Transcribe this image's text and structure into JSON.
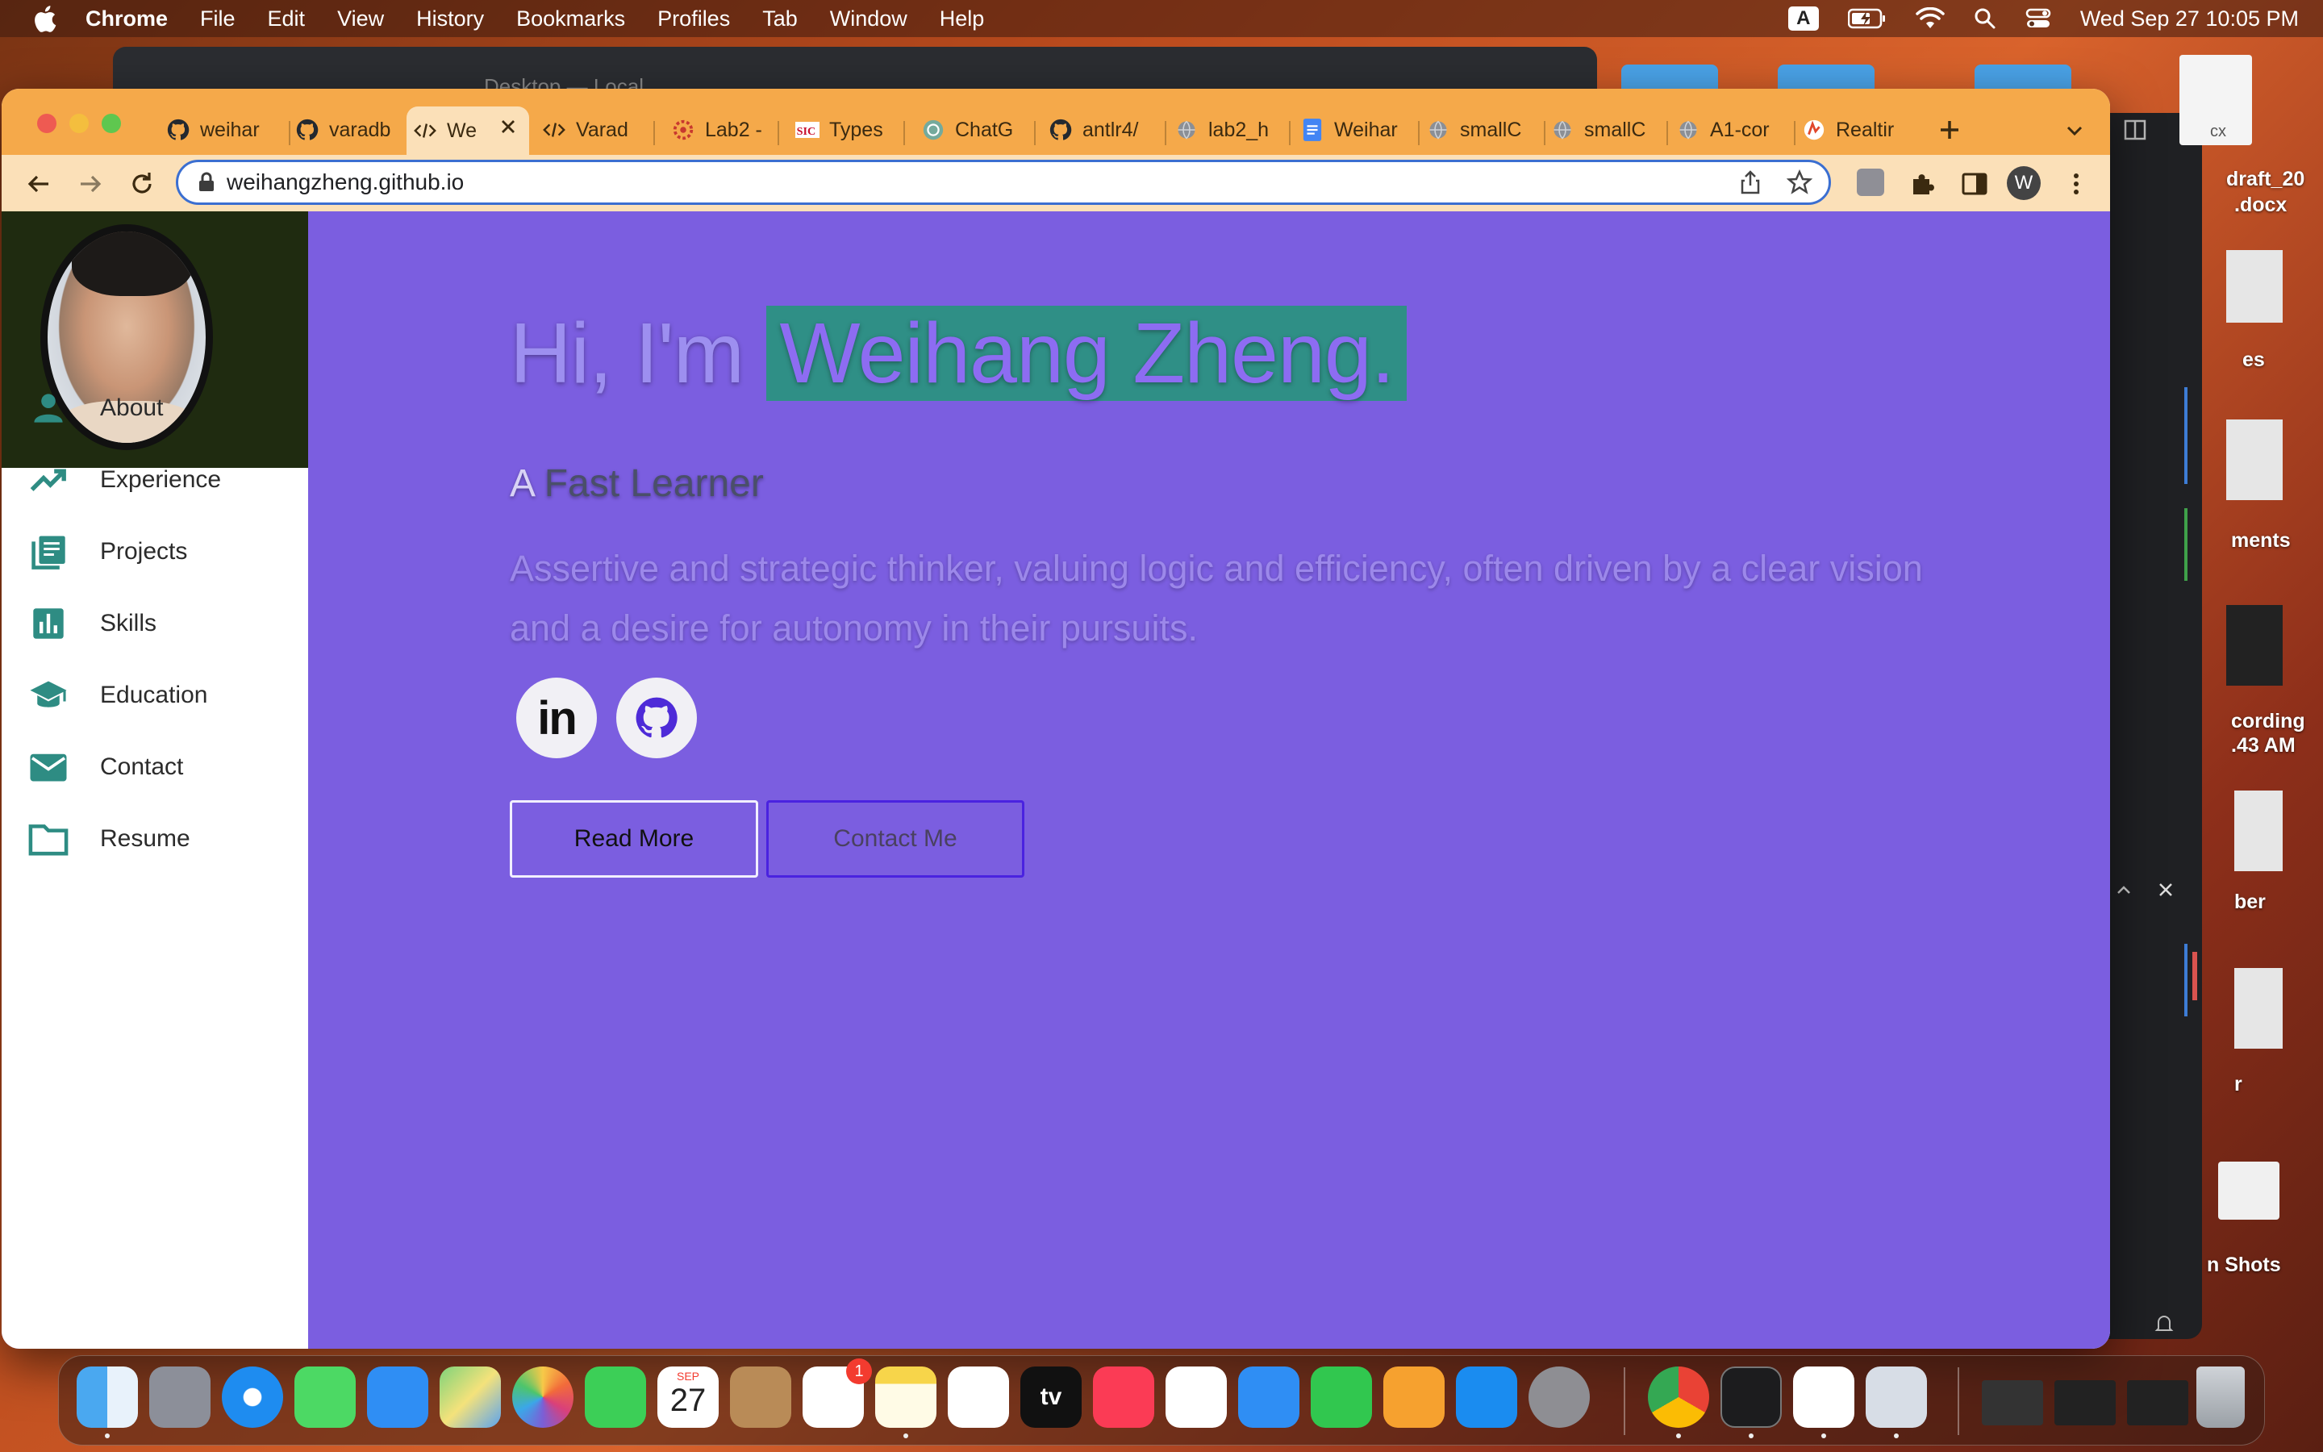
{
  "menubar": {
    "items": [
      "Chrome",
      "File",
      "Edit",
      "View",
      "History",
      "Bookmarks",
      "Profiles",
      "Tab",
      "Window",
      "Help"
    ],
    "input_badge": "A",
    "clock": "Wed Sep 27  10:05 PM"
  },
  "desktop": {
    "labels": [
      "draft_20",
      ".docx",
      "es",
      "ments",
      "cording",
      ".43 AM",
      "ber",
      "r",
      "n Shots",
      "cx"
    ]
  },
  "background_window": {
    "title": "Desktop — Local"
  },
  "tabs": [
    {
      "label": "weihar",
      "icon": "github-icon"
    },
    {
      "label": "varadb",
      "icon": "github-icon"
    },
    {
      "label": "We",
      "icon": "code-icon",
      "active": true
    },
    {
      "label": "Varad",
      "icon": "code-icon"
    },
    {
      "label": "Lab2 -",
      "icon": "gear-red-icon"
    },
    {
      "label": "Types",
      "icon": "sic-icon"
    },
    {
      "label": "ChatG",
      "icon": "openai-icon"
    },
    {
      "label": "antlr4/",
      "icon": "github-icon"
    },
    {
      "label": "lab2_h",
      "icon": "globe-icon"
    },
    {
      "label": "Weihar",
      "icon": "docs-icon"
    },
    {
      "label": "smallC",
      "icon": "globe-icon"
    },
    {
      "label": "smallC",
      "icon": "globe-icon"
    },
    {
      "label": "A1-cor",
      "icon": "globe-icon"
    },
    {
      "label": "Realtir",
      "icon": "realtime-icon"
    }
  ],
  "toolbar": {
    "url": "weihangzheng.github.io",
    "profile_initial": "W"
  },
  "sidebar": {
    "items": [
      {
        "label": "About",
        "icon": "person-icon"
      },
      {
        "label": "Experience",
        "icon": "trending-up-icon"
      },
      {
        "label": "Projects",
        "icon": "articles-icon"
      },
      {
        "label": "Skills",
        "icon": "bar-chart-icon"
      },
      {
        "label": "Education",
        "icon": "school-icon"
      },
      {
        "label": "Contact",
        "icon": "mail-icon"
      },
      {
        "label": "Resume",
        "icon": "folder-icon"
      }
    ]
  },
  "hero": {
    "greeting": "Hi, I'm ",
    "name": "Weihang Zheng.",
    "subtitle_first": "A",
    "subtitle_rest": " Fast Learner",
    "description": "Assertive and strategic thinker, valuing logic and efficiency, often driven by a clear vision and a desire for autonomy in their pursuits.",
    "read_more": "Read More",
    "contact_me": "Contact Me",
    "linkedin_text": "in"
  },
  "dock": {
    "calendar_month": "SEP",
    "calendar_day": "27",
    "reminders_badge": "1",
    "tv_label": "tv"
  },
  "colors": {
    "tabstrip": "#f5a94a",
    "toolbar": "#fbe0b8",
    "page_bg": "#7b5ee0",
    "name_highlight": "#2f8f86",
    "accent_teal": "#2e8c83"
  }
}
